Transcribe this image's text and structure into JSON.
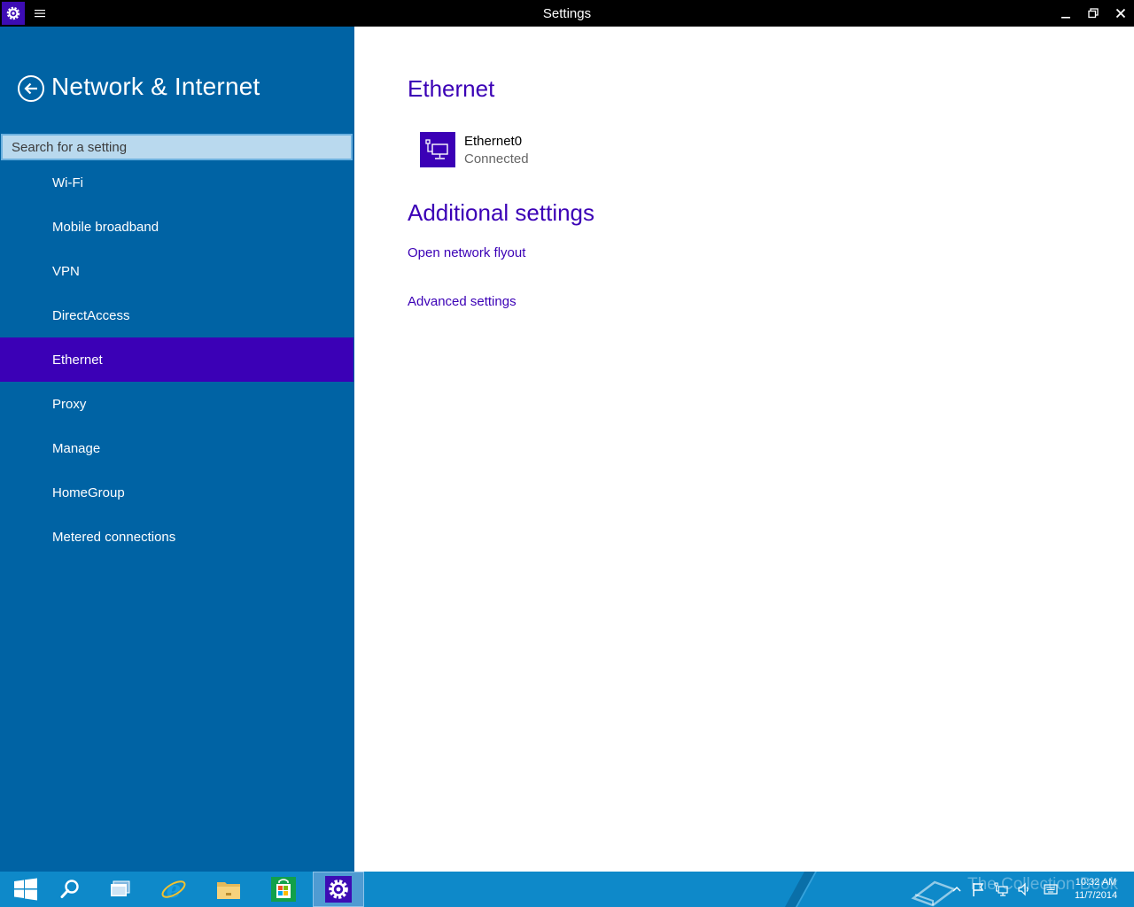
{
  "window": {
    "title": "Settings",
    "app_icon": "gear-icon",
    "controls": [
      "minimize-icon",
      "restore-icon",
      "close-icon"
    ]
  },
  "sidebar": {
    "heading": "Network & Internet",
    "search_placeholder": "Search for a setting",
    "items": [
      {
        "label": "Wi-Fi"
      },
      {
        "label": "Mobile broadband"
      },
      {
        "label": "VPN"
      },
      {
        "label": "DirectAccess"
      },
      {
        "label": "Ethernet",
        "selected": true
      },
      {
        "label": "Proxy"
      },
      {
        "label": "Manage"
      },
      {
        "label": "HomeGroup"
      },
      {
        "label": "Metered connections"
      }
    ]
  },
  "main": {
    "section_title": "Ethernet",
    "adapter": {
      "name": "Ethernet0",
      "status": "Connected",
      "icon": "ethernet-icon"
    },
    "additional_title": "Additional settings",
    "links": [
      "Open network flyout",
      "Advanced settings"
    ]
  },
  "taskbar": {
    "apps": [
      "start-icon",
      "search-icon",
      "task-view-icon",
      "internet-explorer-icon",
      "file-explorer-icon",
      "store-icon",
      "settings-icon"
    ],
    "clock": {
      "time": "10:32 AM",
      "date": "11/7/2014"
    },
    "watermark": "The Collection Book"
  },
  "colors": {
    "accent": "#3b00b6",
    "sidebar_bg": "#0063a4",
    "taskbar_bg": "#0e89c9",
    "titlebar_bg": "#000000"
  }
}
